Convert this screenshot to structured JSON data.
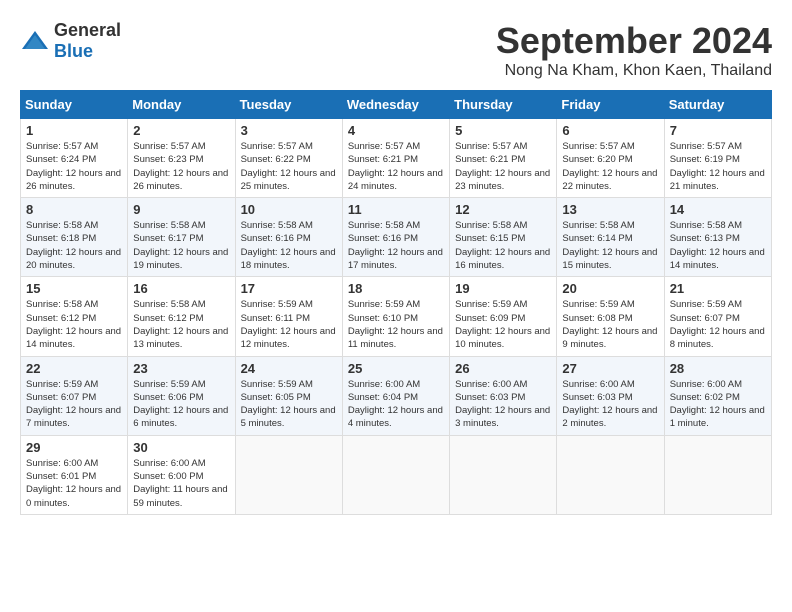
{
  "header": {
    "logo_general": "General",
    "logo_blue": "Blue",
    "month": "September 2024",
    "location": "Nong Na Kham, Khon Kaen, Thailand"
  },
  "weekdays": [
    "Sunday",
    "Monday",
    "Tuesday",
    "Wednesday",
    "Thursday",
    "Friday",
    "Saturday"
  ],
  "weeks": [
    [
      {
        "day": "1",
        "sunrise": "5:57 AM",
        "sunset": "6:24 PM",
        "daylight": "12 hours and 26 minutes."
      },
      {
        "day": "2",
        "sunrise": "5:57 AM",
        "sunset": "6:23 PM",
        "daylight": "12 hours and 26 minutes."
      },
      {
        "day": "3",
        "sunrise": "5:57 AM",
        "sunset": "6:22 PM",
        "daylight": "12 hours and 25 minutes."
      },
      {
        "day": "4",
        "sunrise": "5:57 AM",
        "sunset": "6:21 PM",
        "daylight": "12 hours and 24 minutes."
      },
      {
        "day": "5",
        "sunrise": "5:57 AM",
        "sunset": "6:21 PM",
        "daylight": "12 hours and 23 minutes."
      },
      {
        "day": "6",
        "sunrise": "5:57 AM",
        "sunset": "6:20 PM",
        "daylight": "12 hours and 22 minutes."
      },
      {
        "day": "7",
        "sunrise": "5:57 AM",
        "sunset": "6:19 PM",
        "daylight": "12 hours and 21 minutes."
      }
    ],
    [
      {
        "day": "8",
        "sunrise": "5:58 AM",
        "sunset": "6:18 PM",
        "daylight": "12 hours and 20 minutes."
      },
      {
        "day": "9",
        "sunrise": "5:58 AM",
        "sunset": "6:17 PM",
        "daylight": "12 hours and 19 minutes."
      },
      {
        "day": "10",
        "sunrise": "5:58 AM",
        "sunset": "6:16 PM",
        "daylight": "12 hours and 18 minutes."
      },
      {
        "day": "11",
        "sunrise": "5:58 AM",
        "sunset": "6:16 PM",
        "daylight": "12 hours and 17 minutes."
      },
      {
        "day": "12",
        "sunrise": "5:58 AM",
        "sunset": "6:15 PM",
        "daylight": "12 hours and 16 minutes."
      },
      {
        "day": "13",
        "sunrise": "5:58 AM",
        "sunset": "6:14 PM",
        "daylight": "12 hours and 15 minutes."
      },
      {
        "day": "14",
        "sunrise": "5:58 AM",
        "sunset": "6:13 PM",
        "daylight": "12 hours and 14 minutes."
      }
    ],
    [
      {
        "day": "15",
        "sunrise": "5:58 AM",
        "sunset": "6:12 PM",
        "daylight": "12 hours and 14 minutes."
      },
      {
        "day": "16",
        "sunrise": "5:58 AM",
        "sunset": "6:12 PM",
        "daylight": "12 hours and 13 minutes."
      },
      {
        "day": "17",
        "sunrise": "5:59 AM",
        "sunset": "6:11 PM",
        "daylight": "12 hours and 12 minutes."
      },
      {
        "day": "18",
        "sunrise": "5:59 AM",
        "sunset": "6:10 PM",
        "daylight": "12 hours and 11 minutes."
      },
      {
        "day": "19",
        "sunrise": "5:59 AM",
        "sunset": "6:09 PM",
        "daylight": "12 hours and 10 minutes."
      },
      {
        "day": "20",
        "sunrise": "5:59 AM",
        "sunset": "6:08 PM",
        "daylight": "12 hours and 9 minutes."
      },
      {
        "day": "21",
        "sunrise": "5:59 AM",
        "sunset": "6:07 PM",
        "daylight": "12 hours and 8 minutes."
      }
    ],
    [
      {
        "day": "22",
        "sunrise": "5:59 AM",
        "sunset": "6:07 PM",
        "daylight": "12 hours and 7 minutes."
      },
      {
        "day": "23",
        "sunrise": "5:59 AM",
        "sunset": "6:06 PM",
        "daylight": "12 hours and 6 minutes."
      },
      {
        "day": "24",
        "sunrise": "5:59 AM",
        "sunset": "6:05 PM",
        "daylight": "12 hours and 5 minutes."
      },
      {
        "day": "25",
        "sunrise": "6:00 AM",
        "sunset": "6:04 PM",
        "daylight": "12 hours and 4 minutes."
      },
      {
        "day": "26",
        "sunrise": "6:00 AM",
        "sunset": "6:03 PM",
        "daylight": "12 hours and 3 minutes."
      },
      {
        "day": "27",
        "sunrise": "6:00 AM",
        "sunset": "6:03 PM",
        "daylight": "12 hours and 2 minutes."
      },
      {
        "day": "28",
        "sunrise": "6:00 AM",
        "sunset": "6:02 PM",
        "daylight": "12 hours and 1 minute."
      }
    ],
    [
      {
        "day": "29",
        "sunrise": "6:00 AM",
        "sunset": "6:01 PM",
        "daylight": "12 hours and 0 minutes."
      },
      {
        "day": "30",
        "sunrise": "6:00 AM",
        "sunset": "6:00 PM",
        "daylight": "11 hours and 59 minutes."
      },
      null,
      null,
      null,
      null,
      null
    ]
  ]
}
